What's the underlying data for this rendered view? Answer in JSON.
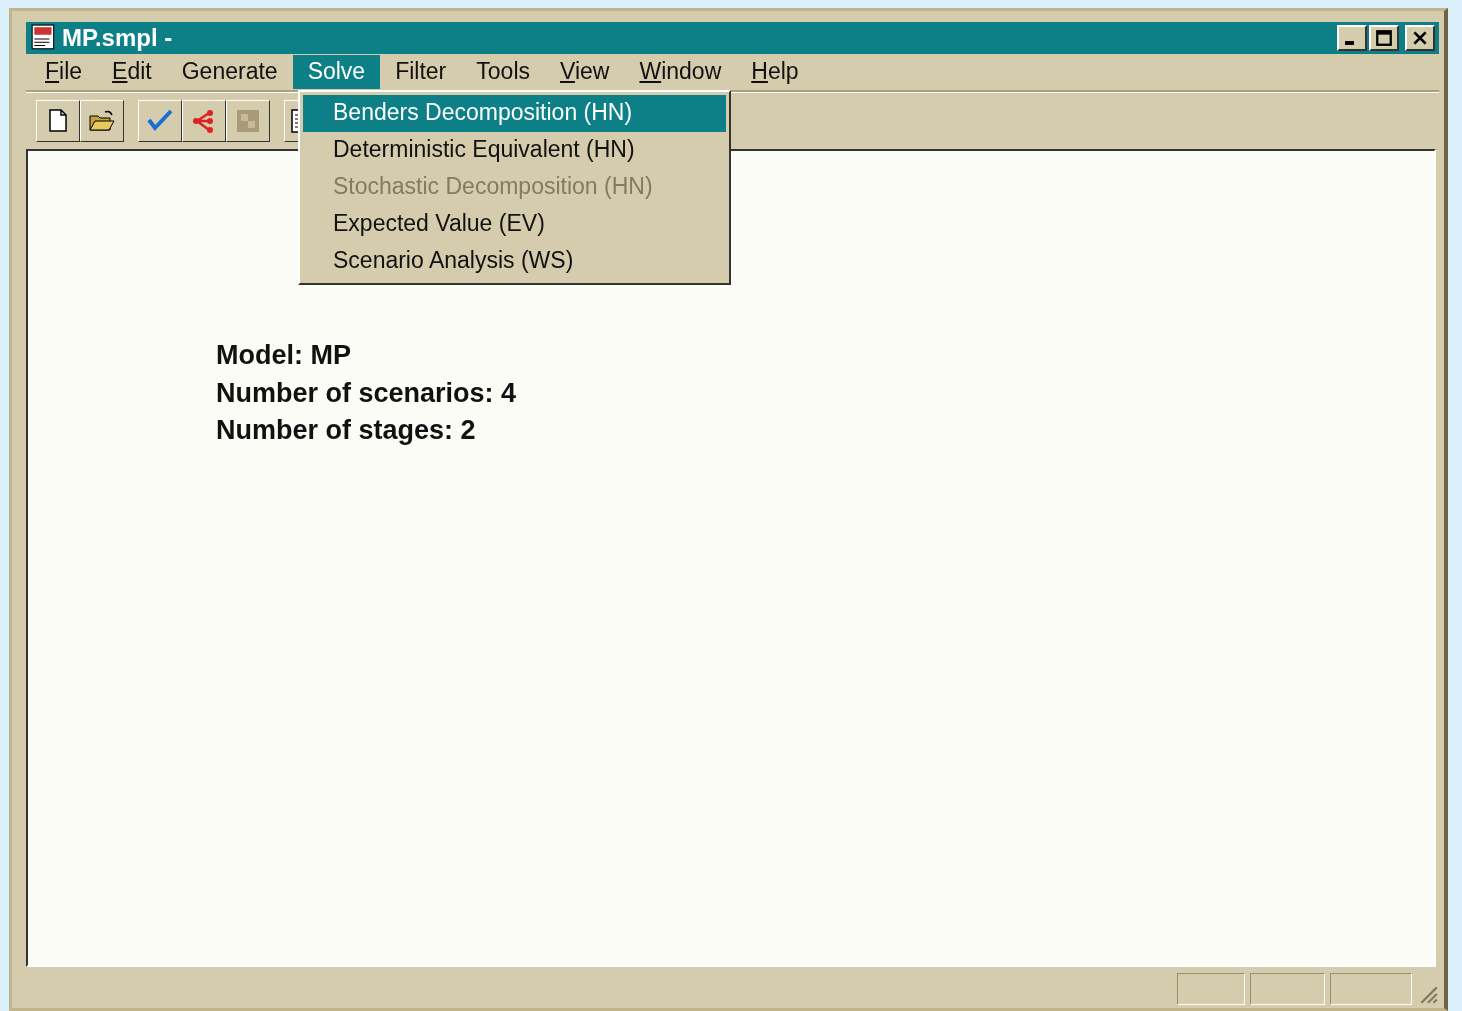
{
  "window": {
    "title": "MP.smpl -"
  },
  "menu": [
    {
      "label": "File",
      "underline_first": true,
      "selected": false
    },
    {
      "label": "Edit",
      "underline_first": true,
      "selected": false
    },
    {
      "label": "Generate",
      "underline_first": false,
      "selected": false
    },
    {
      "label": "Solve",
      "underline_first": false,
      "selected": true
    },
    {
      "label": "Filter",
      "underline_first": false,
      "selected": false
    },
    {
      "label": "Tools",
      "underline_first": false,
      "selected": false
    },
    {
      "label": "View",
      "underline_first": true,
      "selected": false
    },
    {
      "label": "Window",
      "underline_first": true,
      "selected": false
    },
    {
      "label": "Help",
      "underline_first": true,
      "selected": false
    }
  ],
  "toolbar": [
    {
      "kind": "new"
    },
    {
      "kind": "open"
    },
    {
      "kind": "check"
    },
    {
      "kind": "tree"
    },
    {
      "kind": "square"
    },
    {
      "kind": "list"
    }
  ],
  "dropdown": [
    {
      "label": "Benders Decomposition (HN)",
      "selected": true,
      "disabled": false
    },
    {
      "label": "Deterministic Equivalent (HN)",
      "selected": false,
      "disabled": false
    },
    {
      "label": "Stochastic Decomposition (HN)",
      "selected": false,
      "disabled": true
    },
    {
      "label": "Expected Value (EV)",
      "selected": false,
      "disabled": false
    },
    {
      "label": "Scenario Analysis (WS)",
      "selected": false,
      "disabled": false
    }
  ],
  "content": [
    "Model: MP",
    "Number of scenarios: 4",
    "Number of stages: 2"
  ]
}
